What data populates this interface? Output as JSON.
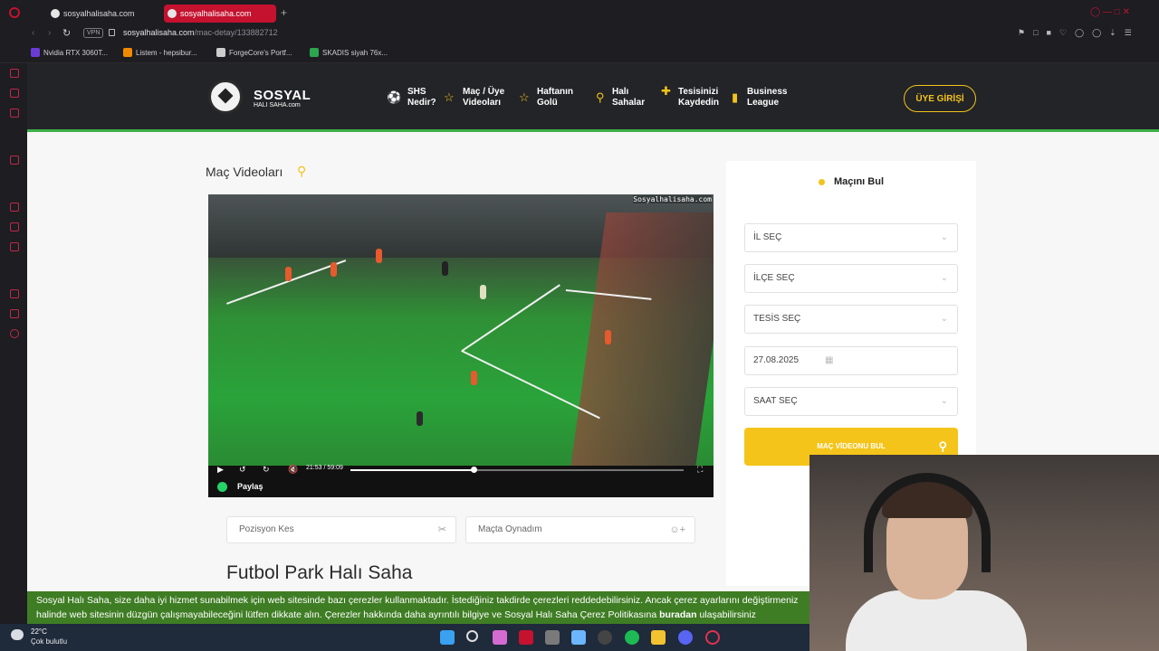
{
  "browser": {
    "tabs": [
      {
        "label": "sosyalhalisaha.com"
      },
      {
        "label": "sosyalhalisaha.com"
      }
    ],
    "vpn_label": "VPN",
    "url_host": "sosyalhalisaha.com",
    "url_path": "/mac-detay/133882712",
    "bookmarks": [
      {
        "label": "Nvidia RTX 3060T...",
        "color": "#6b3bd6"
      },
      {
        "label": "Listem - hepsibur...",
        "color": "#f28a00"
      },
      {
        "label": "ForgeCore's Portf...",
        "color": "#cccccc"
      },
      {
        "label": "SKADIS siyah 76x...",
        "color": "#2da44e"
      }
    ]
  },
  "site": {
    "logo_main": "SOSYAL",
    "logo_sub": "HALI SAHA.com",
    "nav": [
      {
        "line1": "SHS",
        "line2": "Nedir?",
        "icon": "soccer-ball-icon"
      },
      {
        "line1": "Maç / Üye",
        "line2": "Videoları",
        "icon": "trophy-icon"
      },
      {
        "line1": "Haftanın",
        "line2": "Golü",
        "icon": "trophy-icon"
      },
      {
        "line1": "Halı",
        "line2": "Sahalar",
        "icon": "location-pin-icon"
      },
      {
        "line1": "Tesisinizi",
        "line2": "Kaydedin",
        "icon": "plus-icon"
      },
      {
        "line1": "Business",
        "line2": "League",
        "icon": "badge-icon"
      }
    ],
    "login_label": "ÜYE GİRİŞİ",
    "brand_yellow": "#f3c31a",
    "brand_green": "#3fae49"
  },
  "main": {
    "section_title": "Maç Videoları",
    "video": {
      "watermark": "Sosyalhalisaha.com",
      "time": "21:53 / 59:09",
      "progress": 0.37,
      "share_label": "Paylaş"
    },
    "actions": [
      {
        "label": "Pozisyon Kes",
        "icon": "scissors-icon"
      },
      {
        "label": "Maçta Oynadım",
        "icon": "add-user-icon"
      }
    ],
    "venue_title": "Futbol Park Halı Saha"
  },
  "finder": {
    "title": "Maçını Bul",
    "selects": [
      {
        "value": "İL SEÇ"
      },
      {
        "value": "İLÇE SEÇ"
      },
      {
        "value": "TESİS SEÇ"
      },
      {
        "value": "27.08.2025"
      },
      {
        "value": "SAAT SEÇ"
      }
    ],
    "button_label": "MAÇ VİDEONU BUL"
  },
  "cookie": {
    "text": "Sosyal Halı Saha, size daha iyi hizmet sunabilmek için web sitesinde bazı çerezler kullanmaktadır. İstediğiniz takdirde çerezleri reddedebilirsiniz. Ancak çerez ayarlarını değiştirmeniz halinde web sitesinin düzgün çalışmayabileceğini lütfen dikkate alın. Çerezler hakkında daha ayrıntılı bilgiye ve Sosyal Halı Saha Çerez Politikasına",
    "link": "buradan",
    "tail": "ulaşabilirsiniz"
  },
  "taskbar": {
    "temperature": "22°C",
    "weather": "Çok bulutlu"
  }
}
